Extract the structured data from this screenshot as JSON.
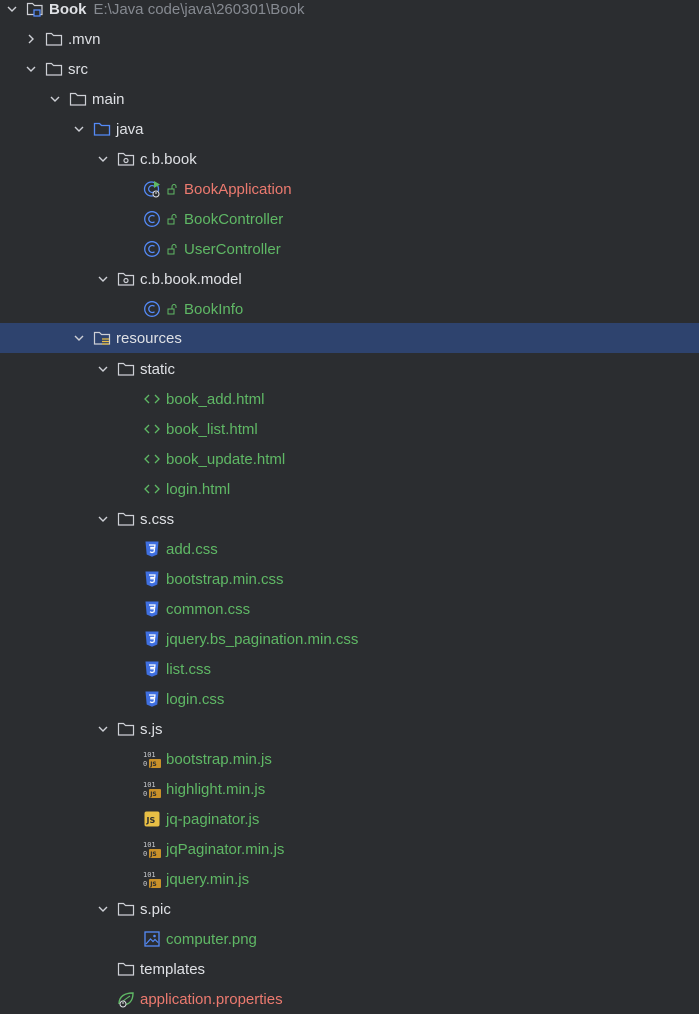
{
  "project": {
    "name": "Book",
    "path": "E:\\Java code\\java\\260301\\Book"
  },
  "rows": [
    {
      "label": ".mvn"
    },
    {
      "label": "src"
    },
    {
      "label": "main"
    },
    {
      "label": "java"
    },
    {
      "label": "c.b.book"
    },
    {
      "label": "BookApplication"
    },
    {
      "label": "BookController"
    },
    {
      "label": "UserController"
    },
    {
      "label": "c.b.book.model"
    },
    {
      "label": "BookInfo"
    },
    {
      "label": "resources"
    },
    {
      "label": "static"
    },
    {
      "label": "book_add.html"
    },
    {
      "label": "book_list.html"
    },
    {
      "label": "book_update.html"
    },
    {
      "label": "login.html"
    },
    {
      "label": "s.css"
    },
    {
      "label": "add.css"
    },
    {
      "label": "bootstrap.min.css"
    },
    {
      "label": "common.css"
    },
    {
      "label": "jquery.bs_pagination.min.css"
    },
    {
      "label": "list.css"
    },
    {
      "label": "login.css"
    },
    {
      "label": "s.js"
    },
    {
      "label": "bootstrap.min.js"
    },
    {
      "label": "highlight.min.js"
    },
    {
      "label": "jq-paginator.js"
    },
    {
      "label": "jqPaginator.min.js"
    },
    {
      "label": "jquery.min.js"
    },
    {
      "label": "s.pic"
    },
    {
      "label": "computer.png"
    },
    {
      "label": "templates"
    },
    {
      "label": "application.properties"
    }
  ],
  "colors": {
    "background": "#2b2d30",
    "selected_row": "#2e436e",
    "text": "#dfe1e5",
    "path_text": "#868a91",
    "vcs_added": "#5fb865",
    "vcs_modified_red": "#ec7a6f",
    "java_class_icon": "#548af7",
    "css_icon": "#3f6fe0",
    "js_icon": "#e8bf45"
  },
  "icons": {
    "chevron_expanded": "chevron-down-icon",
    "chevron_collapsed": "chevron-right-icon",
    "folder": "folder-icon",
    "source_folder": "source-folder-icon",
    "resources_folder": "resources-folder-icon",
    "package": "package-icon",
    "java_class": "java-class-icon",
    "spring_boot_class": "spring-boot-run-icon",
    "html_file": "html-file-icon",
    "css_file": "css-file-icon",
    "js_file": "js-file-icon",
    "minified_js_file": "minified-js-icon",
    "image_file": "image-file-icon",
    "properties_file": "spring-properties-icon",
    "module": "module-icon"
  }
}
